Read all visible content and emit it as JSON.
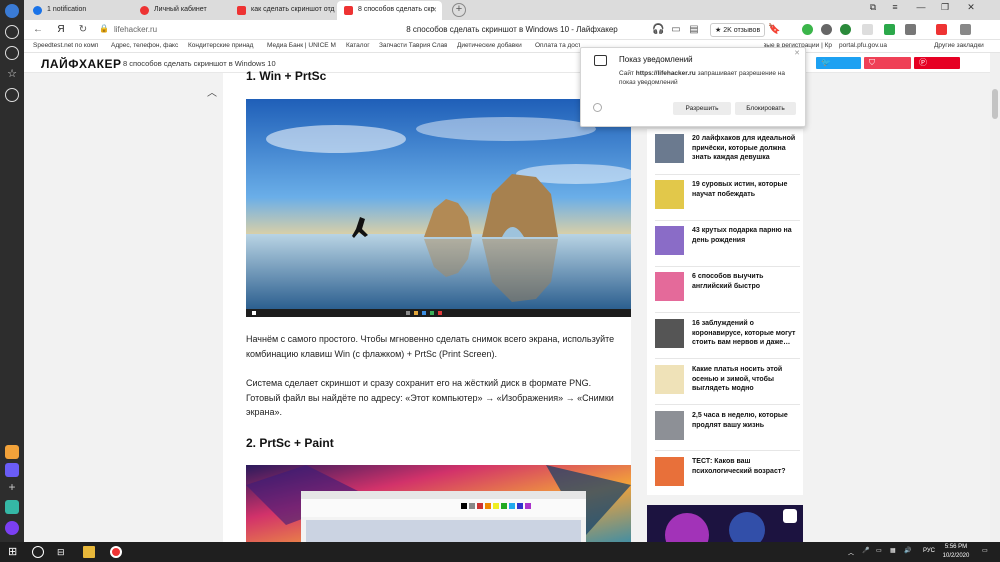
{
  "tabs": [
    {
      "label": "1 notification",
      "color": "#1a73e8"
    },
    {
      "label": "Личный кабинет",
      "color": "#e33"
    },
    {
      "label": "как сделать скриншот отд",
      "color": "#e33"
    },
    {
      "label": "8 способов сделать скр",
      "color": "#e33"
    }
  ],
  "address": {
    "url": "lifehacker.ru",
    "page_title": "8 способов сделать скриншот в Windows 10 - Лайфхакер",
    "reviews": "★ 2K отзывов"
  },
  "bookmarks": [
    "Speedtest.net по комп",
    "Адрес, телефон, факс",
    "Кондитерские принад",
    "Медиа Банк | UNICE M",
    "Каталог",
    "Запчасти Таврия Слав",
    "Диетические добавки",
    "Оплата та доставка",
    "Ключевые в регистрации | Кр",
    "portal.pfu.gov.ua",
    "Другие закладки"
  ],
  "site": {
    "logo": "ЛАЙФХАКЕР",
    "header_title": "8 способов сделать скриншот в Windows 10"
  },
  "article": {
    "h1": "1. Win + PrtSc",
    "p1": "Начнём с самого простого. Чтобы мгновенно сделать снимок всего экрана, используйте комбинацию клавиш Win (с флажком) + PrtSc (Print Screen).",
    "p2": "Система сделает скриншот и сразу сохранит его на жёсткий диск в формате PNG. Готовый файл вы найдёте по адресу: «Этот компьютер» → «Изображения» → «Снимки экрана».",
    "h2": "2. PrtSc + Paint"
  },
  "related": [
    {
      "text": "20 лайфхаков для идеальной причёски, которые должна знать каждая девушка",
      "color": "#6b7a8f"
    },
    {
      "text": "19 суровых истин, которые научат побеждать",
      "color": "#e2c84a"
    },
    {
      "text": "43 крутых подарка парню на день рождения",
      "color": "#8a6cc7"
    },
    {
      "text": "6 способов выучить английский быстро",
      "color": "#e46a9a"
    },
    {
      "text": "16 заблуждений о коронавирусе, которые могут стоить вам нервов и даже…",
      "color": "#555555"
    },
    {
      "text": "Какие платья носить этой осенью и зимой, чтобы выглядеть модно",
      "color": "#efe2b8"
    },
    {
      "text": "2,5 часа в неделю, которые продлят вашу жизнь",
      "color": "#8d9096"
    },
    {
      "text": "ТЕСТ: Каков ваш психологический возраст?",
      "color": "#e8703a"
    }
  ],
  "popup": {
    "title": "Показ уведомлений",
    "site_prefix": "Сайт ",
    "site": "https://lifehacker.ru",
    "body": " запрашивает разрешение на показ уведомлений",
    "allow": "Разрешить",
    "block": "Блокировать"
  },
  "taskbar": {
    "time": "5:56 PM",
    "date": "10/2/2020",
    "lang": "РУС"
  },
  "colors": {
    "twitter": "#1da1f2",
    "pocket": "#ef4056",
    "pinterest": "#e60023"
  }
}
